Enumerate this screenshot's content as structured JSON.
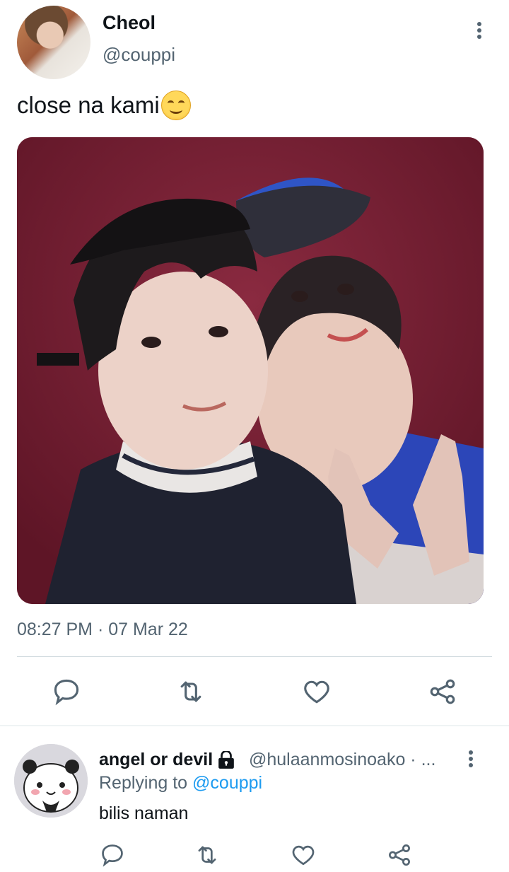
{
  "tweet": {
    "author_name": "Cheol",
    "author_handle": "@couppi",
    "text": "close na kami",
    "emoji": "smiling-face-emoji",
    "timestamp": "08:27 PM · 07 Mar 22"
  },
  "actions": [
    "reply-icon",
    "retweet-icon",
    "like-icon",
    "share-icon"
  ],
  "reply": {
    "author_name": "angel or devil",
    "protected_icon": "lock-icon",
    "author_handle": "@hulaanmosinoako · ...",
    "replying_prefix": "Replying to",
    "replying_to": "@couppi",
    "text": "bilis naman"
  },
  "colors": {
    "text": "#0f1419",
    "secondary": "#536471",
    "link": "#1d9bf0",
    "photo_background": "#7a1f33"
  }
}
